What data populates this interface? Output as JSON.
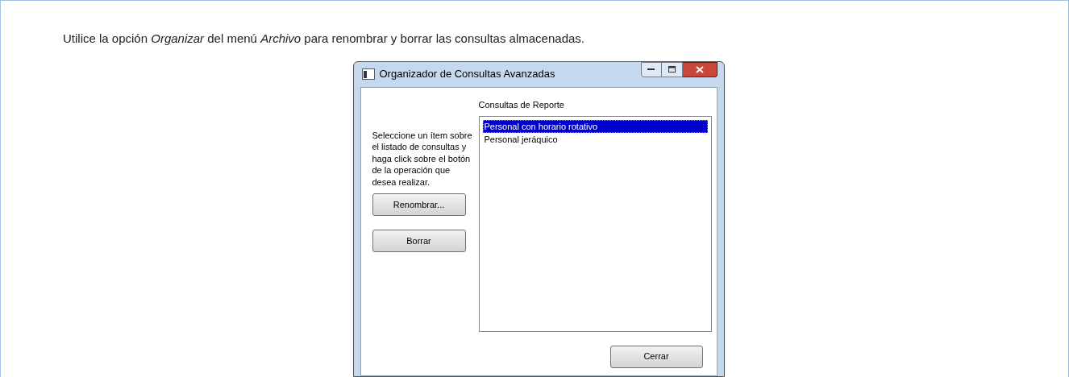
{
  "instruction": "Utilice la opción *Organizar* del menú *Archivo* para renombrar y borrar las consultas almacenadas.",
  "window": {
    "title": "Organizador de Consultas Avanzadas"
  },
  "help_text": "Seleccione un ítem sobre el listado de consultas y haga click sobre el botón de la operación que desea realizar.",
  "buttons": [
    "Renombrar...",
    "Borrar"
  ],
  "list": {
    "label": "Consultas de Reporte",
    "items": [
      {
        "label": "Personal con horario rotativo",
        "selected": true
      },
      {
        "label": "Personal jeráquico",
        "selected": false
      }
    ]
  },
  "close_button": "Cerrar"
}
